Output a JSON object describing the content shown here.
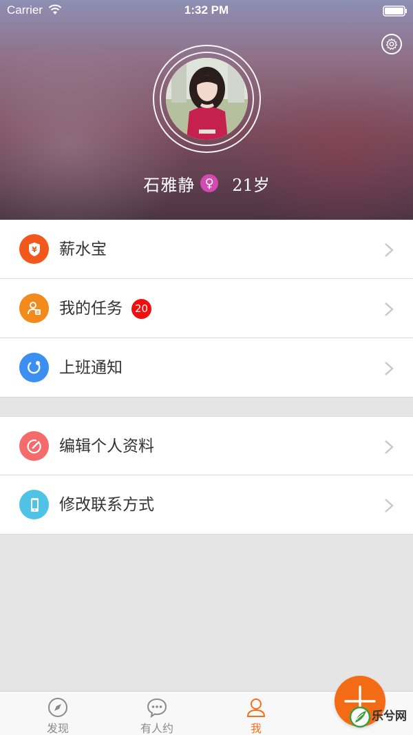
{
  "status_bar": {
    "carrier": "Carrier",
    "time": "1:32 PM"
  },
  "profile": {
    "name": "石雅静",
    "gender_symbol": "♀",
    "age": "21岁"
  },
  "menu": {
    "group1": [
      {
        "label": "薪水宝",
        "icon": "shield-yen-icon",
        "color": "#f2581c"
      },
      {
        "label": "我的任务",
        "icon": "person-task-icon",
        "color": "#f28a1c",
        "badge": "20"
      },
      {
        "label": "上班通知",
        "icon": "refresh-icon",
        "color": "#3a8ff0"
      }
    ],
    "group2": [
      {
        "label": "编辑个人资料",
        "icon": "pencil-edit-icon",
        "color": "#f36b6b"
      },
      {
        "label": "修改联系方式",
        "icon": "phone-icon",
        "color": "#4fc3e6"
      }
    ]
  },
  "tabs": [
    {
      "label": "发现",
      "icon": "compass-icon",
      "active": false
    },
    {
      "label": "有人约",
      "icon": "chat-bubble-icon",
      "active": false
    },
    {
      "label": "我",
      "icon": "person-icon",
      "active": true
    }
  ],
  "watermark": {
    "text": "乐兮网"
  },
  "colors": {
    "accent": "#f2701c",
    "fab": "#f46b15",
    "badge": "#f20e0e",
    "gender": "#d34bb2"
  }
}
